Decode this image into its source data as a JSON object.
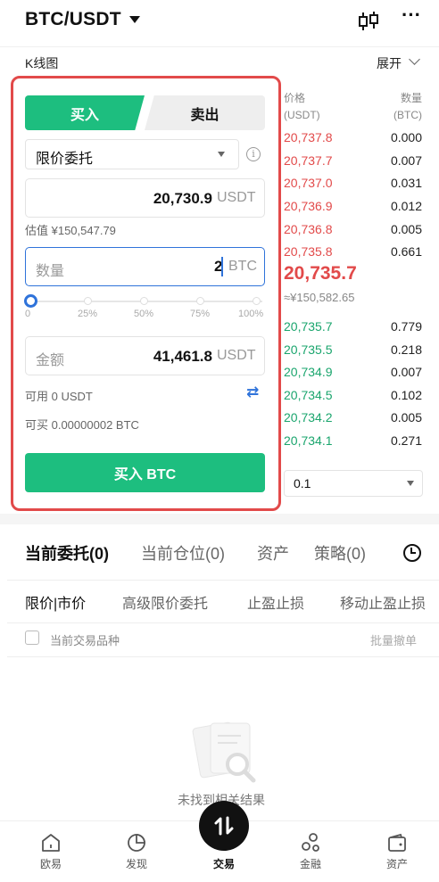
{
  "header": {
    "pair": "BTC/USDT",
    "kline_label": "K线图",
    "expand_label": "展开"
  },
  "form": {
    "tab_buy": "买入",
    "tab_sell": "卖出",
    "order_type": "限价委托",
    "info_icon": "i",
    "price_value": "20,730.9",
    "price_unit": "USDT",
    "estimate": "估值 ¥150,547.79",
    "qty_label": "数量",
    "qty_value": "2",
    "qty_unit": "BTC",
    "slider_value_percent": 0,
    "slider_labels": [
      "0",
      "25%",
      "50%",
      "75%",
      "100%"
    ],
    "amount_label": "金额",
    "amount_value": "41,461.8",
    "amount_unit": "USDT",
    "available": "可用 0 USDT",
    "can_buy": "可买 0.00000002 BTC",
    "buy_button": "买入 BTC"
  },
  "orderbook": {
    "price_header": "价格",
    "price_unit": "(USDT)",
    "qty_header": "数量",
    "qty_unit": "(BTC)",
    "asks": [
      {
        "price": "20,737.8",
        "qty": "0.000"
      },
      {
        "price": "20,737.7",
        "qty": "0.007"
      },
      {
        "price": "20,737.0",
        "qty": "0.031"
      },
      {
        "price": "20,736.9",
        "qty": "0.012"
      },
      {
        "price": "20,736.8",
        "qty": "0.005"
      },
      {
        "price": "20,735.8",
        "qty": "0.661"
      }
    ],
    "last_price": "20,735.7",
    "last_cny": "≈¥150,582.65",
    "bids": [
      {
        "price": "20,735.7",
        "qty": "0.779"
      },
      {
        "price": "20,735.5",
        "qty": "0.218"
      },
      {
        "price": "20,734.9",
        "qty": "0.007"
      },
      {
        "price": "20,734.5",
        "qty": "0.102"
      },
      {
        "price": "20,734.2",
        "qty": "0.005"
      },
      {
        "price": "20,734.1",
        "qty": "0.271"
      }
    ],
    "precision": "0.1"
  },
  "orders": {
    "tabs": [
      "当前委托(0)",
      "当前仓位(0)",
      "资产",
      "策略(0)"
    ],
    "sub_tabs": [
      "限价|市价",
      "高级限价委托",
      "止盈止损",
      "移动止盈止损"
    ],
    "current_pair_only": "当前交易品种",
    "batch_cancel": "批量撤单",
    "empty_text": "未找到相关结果"
  },
  "nav": {
    "items": [
      {
        "label": "欧易",
        "icon": "home-icon"
      },
      {
        "label": "发现",
        "icon": "discover-icon"
      },
      {
        "label": "交易",
        "icon": "trade-icon"
      },
      {
        "label": "金融",
        "icon": "finance-icon"
      },
      {
        "label": "资产",
        "icon": "wallet-icon"
      }
    ]
  },
  "colors": {
    "buy_green": "#1dbe7f",
    "sell_red": "#e24a4a",
    "accent_blue": "#2f73da",
    "highlight_border": "#e24a4a"
  }
}
